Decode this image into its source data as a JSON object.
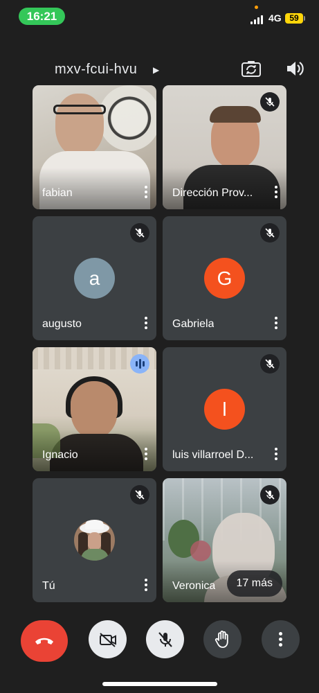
{
  "status_bar": {
    "time": "16:21",
    "network": "4G",
    "battery": "59"
  },
  "meeting": {
    "code": "mxv-fcui-hvu"
  },
  "participants": [
    {
      "name": "fabian",
      "muted": false
    },
    {
      "name": "Dirección Prov...",
      "muted": true
    },
    {
      "name": "augusto",
      "muted": true,
      "avatar_letter": "a",
      "avatar_color": "#7f98a6"
    },
    {
      "name": "Gabriela",
      "muted": true,
      "avatar_letter": "G",
      "avatar_color": "#f4511e"
    },
    {
      "name": "Ignacio",
      "muted": false,
      "speaking": true
    },
    {
      "name": "luis villarroel D...",
      "muted": true,
      "avatar_letter": "l",
      "avatar_color": "#f4511e"
    },
    {
      "name": "Tú",
      "muted": true
    },
    {
      "name": "Veronica",
      "muted": true
    }
  ],
  "overflow": {
    "label": "17 más"
  },
  "colors": {
    "end_call": "#ea4335",
    "speaking": "#8ab4f8",
    "status_time_pill": "#34c759",
    "battery": "#ffd60a"
  }
}
